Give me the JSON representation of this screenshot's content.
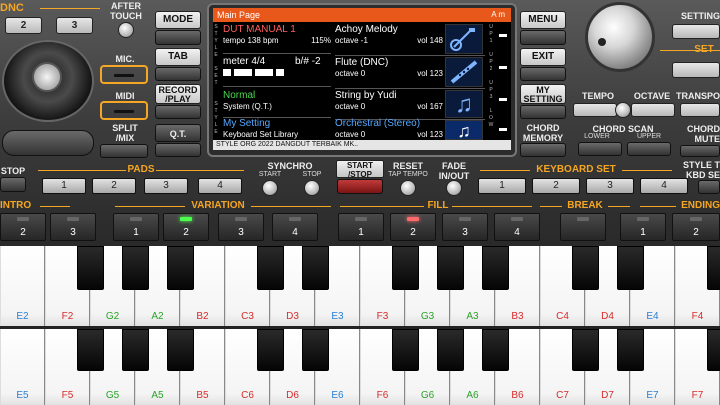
{
  "top_left": {
    "dnc": "DNC",
    "btn_2": "2",
    "btn_3": "3",
    "after_touch": "AFTER\nTOUCH",
    "mic": "MIC.",
    "midi": "MIDI",
    "split_mix": "SPLIT\n/MIX"
  },
  "left_column": {
    "mode": "MODE",
    "tab": "TAB",
    "record_play": "RECORD\n/PLAY",
    "qt": "Q.T."
  },
  "screen": {
    "title": "Main Page",
    "key": "A m",
    "left_side": [
      "S",
      "T",
      "Y",
      "L",
      "E",
      "",
      "S",
      "E",
      "T",
      "",
      "U",
      "P",
      "",
      "",
      "",
      "",
      "",
      "",
      "",
      "",
      ""
    ],
    "cells": [
      {
        "title": "DUT MANUAL 1",
        "title_color": "#ff5e5e",
        "sub1": "tempo 138 bpm",
        "sub2": "115%"
      },
      {
        "title": "meter 4/4",
        "title_color": "#ffffff",
        "sub1": "b/#",
        "sub2": "-2"
      },
      {
        "title": "Normal",
        "title_color": "#4dd94d",
        "sub1": "System (Q.T.)",
        "sub2": ""
      },
      {
        "title": "My Setting",
        "title_color": "#57a8ff",
        "sub1": "Keyboard Set Library",
        "sub2": ""
      }
    ],
    "voices": [
      {
        "name": "Achoy Melody",
        "octave": "octave -1",
        "vol": "vol 148",
        "icon": "guitar-icon"
      },
      {
        "name": "Flute (DNC)",
        "octave": "octave 0",
        "vol": "vol 123",
        "icon": "flute-icon"
      },
      {
        "name": "String by Yudi",
        "octave": "octave 0",
        "vol": "vol 167",
        "icon": "music-note-icon"
      },
      {
        "name": "Orchestral (Stereo)",
        "octave": "octave 0",
        "vol": "vol 123",
        "icon": "music-note-icon"
      }
    ],
    "upper_labels": [
      "U",
      "P",
      "1",
      "",
      "U",
      "P",
      "2",
      "",
      "U",
      "P",
      "3",
      "",
      "L",
      "O",
      "W"
    ],
    "footer": "STYLE ORG 2022 DANGDUT TERBAIK MK.."
  },
  "right_column": {
    "menu": "MENU",
    "exit": "EXIT",
    "my_setting": "MY\nSETTING",
    "chord_memory": "CHORD\nMEMORY"
  },
  "right_panel": {
    "setting": "SETTING",
    "set": "SET",
    "tempo": "TEMPO",
    "octave": "OCTAVE",
    "transpose": "TRANSPO",
    "chord_scan": "CHORD SCAN",
    "lower": "LOWER",
    "upper": "UPPER",
    "chord_mute": "CHORD\nMUTE"
  },
  "middle": {
    "stop": "STOP",
    "pads": "PADS",
    "pad_buttons": [
      "1",
      "2",
      "3",
      "4"
    ],
    "synchro": "SYNCHRO",
    "start": "START",
    "stop2": "STOP",
    "start_stop": "START\n/STOP",
    "reset": "RESET",
    "tap_tempo": "TAP TEMPO",
    "fade": "FADE\nIN/OUT",
    "keyboard_set": "KEYBOARD SET",
    "kbd_buttons": [
      "1",
      "2",
      "3",
      "4"
    ],
    "style_kbd": "STYLE T\nKBD SE"
  },
  "sections": {
    "intro": "INTRO",
    "variation": "VARIATION",
    "fill": "FILL",
    "break": "BREAK",
    "ending": "ENDING",
    "buttons": [
      {
        "label": "2",
        "led": ""
      },
      {
        "label": "3",
        "led": ""
      },
      {
        "label": "1",
        "led": ""
      },
      {
        "label": "2",
        "led": "green"
      },
      {
        "label": "3",
        "led": ""
      },
      {
        "label": "4",
        "led": ""
      },
      {
        "label": "1",
        "led": ""
      },
      {
        "label": "2",
        "led": "red"
      },
      {
        "label": "3",
        "led": ""
      },
      {
        "label": "4",
        "led": ""
      },
      {
        "label": "",
        "led": ""
      },
      {
        "label": "1",
        "led": ""
      },
      {
        "label": "2",
        "led": ""
      }
    ]
  },
  "keyboard_top": [
    "E2",
    "F2",
    "G2",
    "A2",
    "B2",
    "C3",
    "D3",
    "E3",
    "F3",
    "G3",
    "A3",
    "B3",
    "C4",
    "D4",
    "E4",
    "F4"
  ],
  "keyboard_bottom": [
    "E5",
    "F5",
    "G5",
    "A5",
    "B5",
    "C6",
    "D6",
    "E6",
    "F6",
    "G6",
    "A6",
    "B6",
    "C7",
    "D7",
    "E7",
    "F7"
  ],
  "colors": {
    "accent": "#f5a623",
    "screen_title": "#e8581a",
    "key_blue": "#2a7fd4",
    "key_red": "#d82b2b",
    "key_green": "#2aa32a"
  }
}
